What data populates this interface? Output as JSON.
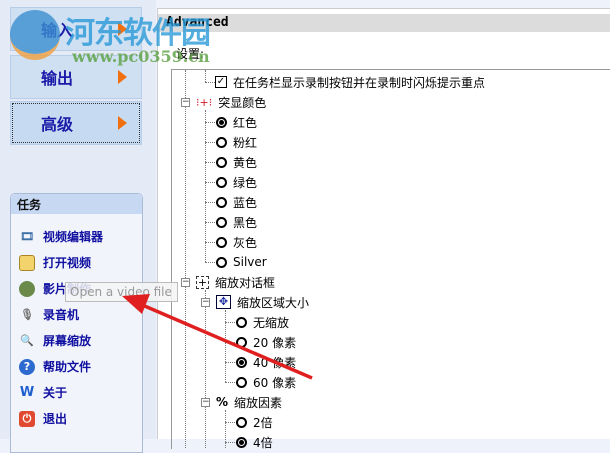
{
  "nav": {
    "items": [
      {
        "label": "输入"
      },
      {
        "label": "输出"
      },
      {
        "label": "高级"
      }
    ]
  },
  "tasks": {
    "title": "任务",
    "items": [
      {
        "label": "视频编辑器",
        "icon": "film-icon"
      },
      {
        "label": "打开视频",
        "icon": "folder-open-icon"
      },
      {
        "label": "影片制作",
        "icon": "movie-maker-icon"
      },
      {
        "label": "录音机",
        "icon": "microphone-icon"
      },
      {
        "label": "屏幕缩放",
        "icon": "magnifier-icon"
      },
      {
        "label": "帮助文件",
        "icon": "help-icon"
      },
      {
        "label": "关于",
        "icon": "about-icon"
      },
      {
        "label": "退出",
        "icon": "exit-icon"
      }
    ]
  },
  "tooltip": "Open a video file",
  "main": {
    "title": "Advanced",
    "settings_label": "设置:",
    "taskbar_option": "在任务栏显示录制按钮并在录制时闪烁提示重点",
    "highlight": {
      "label": "突显颜色",
      "options": [
        "红色",
        "粉红",
        "黄色",
        "绿色",
        "蓝色",
        "黑色",
        "灰色",
        "Silver"
      ],
      "selected": 0
    },
    "zoom_dialog": {
      "label": "缩放对话框",
      "area": {
        "label": "缩放区域大小",
        "options": [
          "无缩放",
          "20 像素",
          "40 像素",
          "60 像素"
        ],
        "selected": 2
      },
      "factor": {
        "label": "缩放因素",
        "options": [
          "2倍",
          "4倍"
        ],
        "selected": 1
      }
    }
  },
  "watermark": {
    "title": "河东软件园",
    "url": "www.pc0359.cn"
  },
  "colors": {
    "accent": "#1a1aa8",
    "arrow": "#e02020",
    "nav_arrow": "#f07010"
  }
}
